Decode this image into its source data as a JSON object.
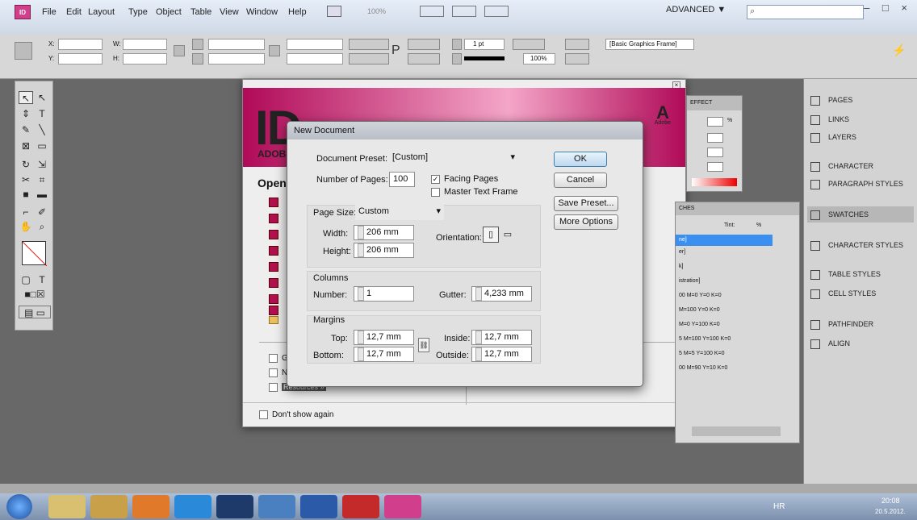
{
  "menubar": {
    "app_icon": "ID",
    "items": [
      "File",
      "Edit",
      "Layout",
      "Type",
      "Object",
      "Table",
      "View",
      "Window",
      "Help"
    ],
    "zoom": "100%",
    "workspace": "ADVANCED ▼",
    "window_controls": "– □ ×"
  },
  "controlbar": {
    "x_label": "X:",
    "y_label": "Y:",
    "w_label": "W:",
    "h_label": "H:",
    "stroke_weight": "1 pt",
    "opacity": "100%",
    "frame_style": "[Basic Graphics Frame]"
  },
  "splash": {
    "logo": "ID",
    "brand": "ADOB",
    "adobe_mark": "A",
    "adobe_word": "Adobe",
    "open_heading": "Open",
    "bottom_items": [
      "G",
      "N",
      "Resources »"
    ],
    "dont_show": "Don't show again"
  },
  "dialog": {
    "title": "New Document",
    "preset_label": "Document Preset:",
    "preset_value": "[Custom]",
    "pages_label": "Number of Pages:",
    "pages_value": "100",
    "facing_pages": "Facing Pages",
    "master_text_frame": "Master Text Frame",
    "page_size_label": "Page Size:",
    "page_size_value": "Custom",
    "width_label": "Width:",
    "width_value": "206 mm",
    "height_label": "Height:",
    "height_value": "206 mm",
    "orientation_label": "Orientation:",
    "columns_heading": "Columns",
    "number_label": "Number:",
    "number_value": "1",
    "gutter_label": "Gutter:",
    "gutter_value": "4,233 mm",
    "margins_heading": "Margins",
    "top_label": "Top:",
    "top_value": "12,7 mm",
    "bottom_label": "Bottom:",
    "bottom_value": "12,7 mm",
    "inside_label": "Inside:",
    "inside_value": "12,7 mm",
    "outside_label": "Outside:",
    "outside_value": "12,7 mm",
    "ok": "OK",
    "cancel": "Cancel",
    "save_preset": "Save Preset...",
    "more_options": "More Options"
  },
  "right_dock": {
    "items": [
      "PAGES",
      "LINKS",
      "LAYERS",
      "CHARACTER",
      "PARAGRAPH STYLES",
      "SWATCHES",
      "CHARACTER STYLES",
      "TABLE STYLES",
      "CELL STYLES",
      "PATHFINDER",
      "ALIGN"
    ]
  },
  "swatches_panel": {
    "tab": "CHES",
    "tint_label": "Tint:",
    "tint_unit": "%",
    "rows": [
      "ne]",
      "er]",
      "k]",
      "istration]",
      "00 M=0 Y=0 K=0",
      "M=100 Y=0 K=0",
      "M=0 Y=100 K=0",
      "5 M=100 Y=100 K=0",
      "5 M=5 Y=100 K=0",
      "00 M=90 Y=10 K=0"
    ]
  },
  "effects_panel": {
    "tab": "EFFECT",
    "pct": "%"
  },
  "taskbar": {
    "lang": "HR",
    "time": "20:08",
    "date": "20.5.2012."
  },
  "colors": {
    "indesign_pink": "#d03e8c",
    "dialog_bg": "#e8e8e8",
    "workspace_gray": "#686868"
  }
}
